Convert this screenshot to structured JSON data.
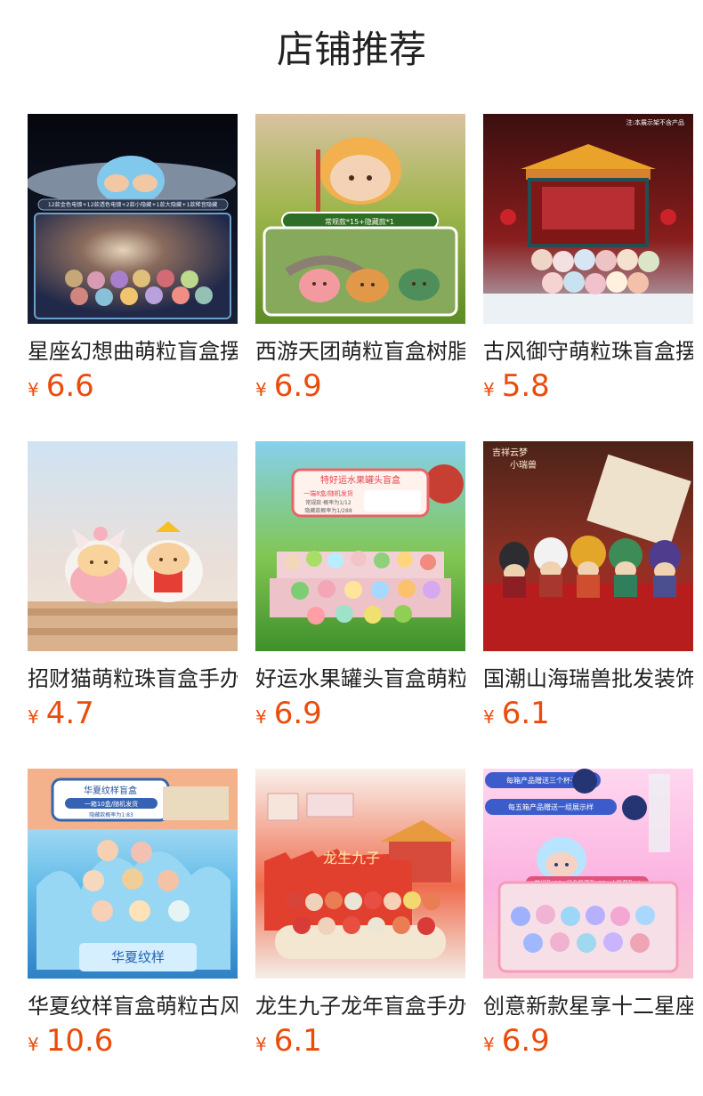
{
  "section": {
    "title": "店铺推荐"
  },
  "products": [
    {
      "name": "星座幻想曲萌粒盲盒摆件",
      "currency": "¥",
      "price": "6.6",
      "image_text": [
        "12款金色电镀+12款透色电镀+2款小隐藏+1款大隐藏+1款稀音隐藏"
      ]
    },
    {
      "name": "西游天团萌粒盲盒树脂摆件",
      "currency": "¥",
      "price": "6.9",
      "image_text": [
        "常规款*15+隐藏款*1"
      ]
    },
    {
      "name": "古风御守萌粒珠盲盒摆件",
      "currency": "¥",
      "price": "5.8",
      "image_text": [
        "注:本展示架不含产品"
      ]
    },
    {
      "name": "招财猫萌粒珠盲盒手办摆件",
      "currency": "¥",
      "price": "4.7",
      "image_text": []
    },
    {
      "name": "好运水果罐头盲盒萌粒摆件",
      "currency": "¥",
      "price": "6.9",
      "image_text": [
        "特好运水果罐头盲盒",
        "一端8盒/随机发货",
        "常规款·概率为1/12",
        "隐藏款概率为1/288"
      ]
    },
    {
      "name": "国潮山海瑞兽批发装饰摆件",
      "currency": "¥",
      "price": "6.1",
      "image_text": [
        "吉祥云梦",
        "小瑞兽"
      ]
    },
    {
      "name": "华夏纹样盲盒萌粒古风摆件",
      "currency": "¥",
      "price": "10.6",
      "image_text": [
        "华夏纹样盲盒",
        "一箱10盒/随机发货",
        "隐藏款概率为1:83",
        "华夏纹样"
      ]
    },
    {
      "name": "龙生九子龙年盲盒手办摆件",
      "currency": "¥",
      "price": "6.1",
      "image_text": [
        "龙生九子"
      ]
    },
    {
      "name": "创意新款星享十二星座盲盒",
      "currency": "¥",
      "price": "6.9",
      "image_text": [
        "每箱产品赠送三个杯子",
        "每五箱产品赠送一组展示样",
        "常规款*12+异色隐藏款*12+大隐藏款*4"
      ]
    }
  ],
  "colors": {
    "price": "#ea4c0c",
    "text": "#222222",
    "background": "#ffffff"
  }
}
